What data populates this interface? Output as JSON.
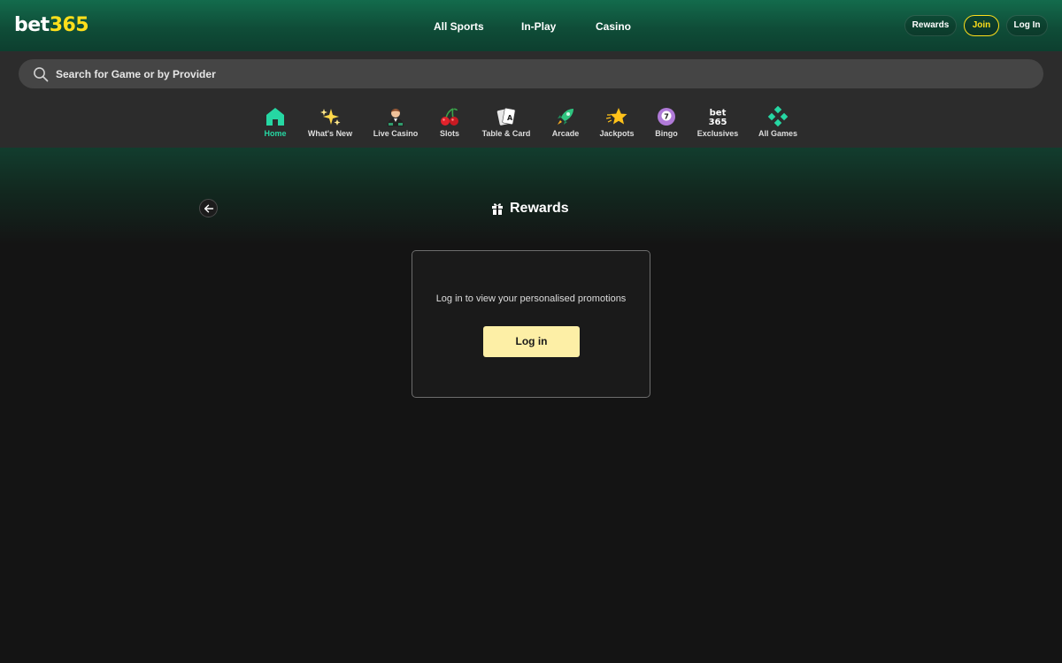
{
  "header": {
    "logo_text_white": "bet",
    "logo_text_yellow": "365",
    "nav": [
      "All Sports",
      "In-Play",
      "Casino"
    ],
    "buttons": {
      "rewards": "Rewards",
      "join": "Join",
      "login": "Log In"
    }
  },
  "search": {
    "placeholder": "Search for Game or by Provider",
    "icon": "search-icon"
  },
  "categories": [
    {
      "label": "Home",
      "icon": "home-icon",
      "active": true
    },
    {
      "label": "What's New",
      "icon": "sparkles-icon",
      "active": false
    },
    {
      "label": "Live Casino",
      "icon": "dealer-icon",
      "active": false
    },
    {
      "label": "Slots",
      "icon": "cherries-icon",
      "active": false
    },
    {
      "label": "Table & Card",
      "icon": "playing-cards-icon",
      "active": false
    },
    {
      "label": "Arcade",
      "icon": "rocket-icon",
      "active": false
    },
    {
      "label": "Jackpots",
      "icon": "star-icon",
      "active": false
    },
    {
      "label": "Bingo",
      "icon": "bingo-ball-icon",
      "active": false
    },
    {
      "label": "Exclusives",
      "icon": "bet365-mini-logo-icon",
      "active": false,
      "icon_text": [
        "bet",
        "365"
      ]
    },
    {
      "label": "All Games",
      "icon": "diamond-grid-icon",
      "active": false
    }
  ],
  "page": {
    "title": "Rewards",
    "title_icon": "gift-icon",
    "back_icon": "arrow-left-icon",
    "card": {
      "message": "Log in to view your personalised promotions",
      "button": "Log in"
    }
  },
  "colors": {
    "brand_green": "#136b4c",
    "brand_yellow": "#ffdf1b",
    "accent_teal": "#26d7a3",
    "login_button": "#fdefa6",
    "background": "#141414"
  }
}
